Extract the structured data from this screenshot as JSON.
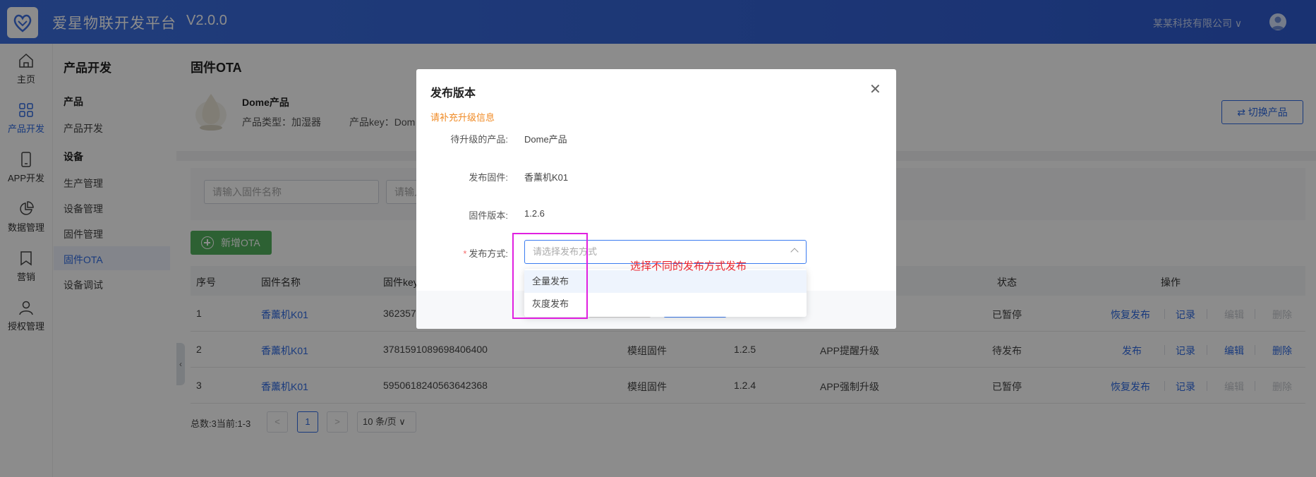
{
  "header": {
    "app_title": "爱星物联开发平台",
    "version": "V2.0.0",
    "company": "某某科技有限公司 ∨"
  },
  "icon_nav": [
    {
      "label": "主页",
      "icon": "home-icon"
    },
    {
      "label": "产品开发",
      "icon": "grid-icon",
      "active": true
    },
    {
      "label": "APP开发",
      "icon": "phone-icon"
    },
    {
      "label": "数据管理",
      "icon": "pie-chart-icon"
    },
    {
      "label": "营销",
      "icon": "bookmark-icon"
    },
    {
      "label": "授权管理",
      "icon": "user-icon"
    }
  ],
  "sub_nav": {
    "title": "产品开发",
    "group1": "产品",
    "group1_items": [
      "产品开发"
    ],
    "group2": "设备",
    "group2_items": [
      "生产管理",
      "设备管理",
      "固件管理",
      "固件OTA",
      "设备调试"
    ]
  },
  "page": {
    "title": "固件OTA",
    "product_name": "Dome产品",
    "product_type": "产品类型：加湿器",
    "product_key": "产品key：Dom",
    "switch_button": "⇄  切换产品",
    "search_firmware_placeholder": "请输入固件名称",
    "search2_placeholder": "请输入",
    "add_button": "新增OTA"
  },
  "table": {
    "headers": [
      "序号",
      "固件名称",
      "固件key",
      "状态",
      "操作"
    ],
    "rows": [
      {
        "no": "1",
        "name": "香薰机K01",
        "key": "362357",
        "type": "",
        "version": "",
        "upgrade": "",
        "status": "已暂停",
        "op1": "恢复发布",
        "op2": "记录",
        "op3": "编辑",
        "op4": "删除",
        "op3_disabled": true,
        "op4_disabled": true
      },
      {
        "no": "2",
        "name": "香薰机K01",
        "key": "3781591089698406400",
        "type": "模组固件",
        "version": "1.2.5",
        "upgrade": "APP提醒升级",
        "status": "待发布",
        "op1": "发布",
        "op2": "记录",
        "op3": "编辑",
        "op4": "删除",
        "op3_disabled": false,
        "op4_disabled": false
      },
      {
        "no": "3",
        "name": "香薰机K01",
        "key": "5950618240563642368",
        "type": "模组固件",
        "version": "1.2.4",
        "upgrade": "APP强制升级",
        "status": "已暂停",
        "op1": "恢复发布",
        "op2": "记录",
        "op3": "编辑",
        "op4": "删除",
        "op3_disabled": true,
        "op4_disabled": true
      }
    ]
  },
  "pagination": {
    "total": "总数:3当前:1-3",
    "prev": "<",
    "current": "1",
    "next": ">",
    "page_size": "10 条/页 ∨"
  },
  "modal": {
    "title": "发布版本",
    "close": "✕",
    "hint": "请补充升级信息",
    "fields": [
      {
        "label": "待升级的产品:",
        "value": "Dome产品"
      },
      {
        "label": "发布固件:",
        "value": "香薰机K01"
      },
      {
        "label": "固件版本:",
        "value": "1.2.6"
      }
    ],
    "release_label": "发布方式:",
    "required_mark": "*",
    "release_placeholder": "请选择发布方式",
    "options": [
      "全量发布",
      "灰度发布"
    ]
  },
  "annotation": "选择不同的发布方式发布",
  "colors": {
    "primary": "#2f6be3",
    "header": "#3c6fe0",
    "add_button": "#52b15d",
    "hint": "#f08a24",
    "annotation": "#e8232e",
    "highlight": "#e020e0"
  }
}
